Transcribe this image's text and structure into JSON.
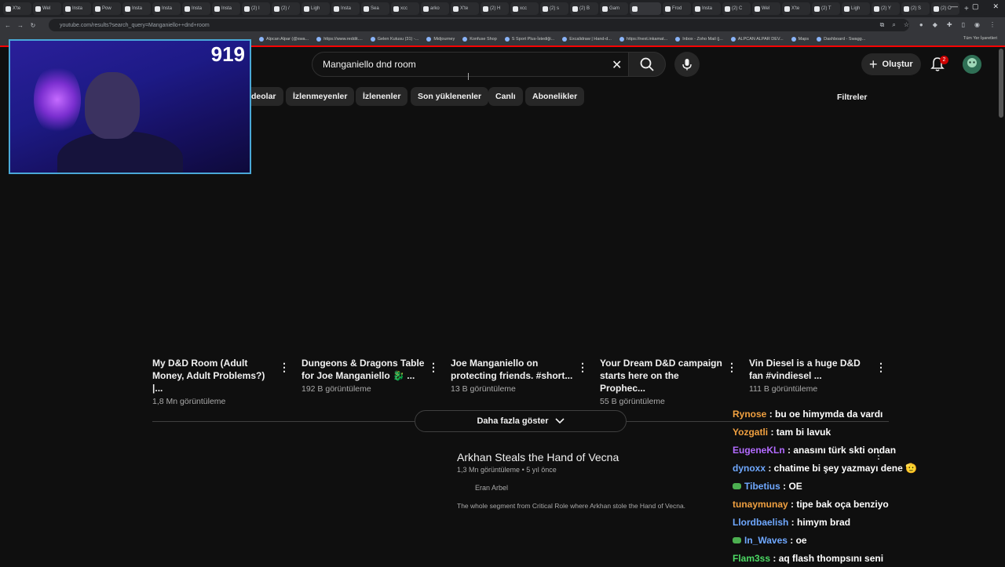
{
  "browser": {
    "tabs": [
      "X'te",
      "Wel",
      "Insta",
      "Pow",
      "Insta",
      "Insta",
      "Insta",
      "Insta",
      "(2) I",
      "(2) /",
      "Ligh",
      "Insta",
      "Sea",
      "xcc",
      "arko",
      "X'te",
      "(2) H",
      "xcc",
      "(2) s",
      "(2) B",
      "Gam",
      "",
      "Frod",
      "Insta",
      "(2) C",
      "Wel",
      "X'te",
      "(2) T",
      "Ligh",
      "(2) Y",
      "(2) S",
      "(2) O"
    ],
    "url": "youtube.com/results?search_query=Manganiello++dnd+room",
    "bookmarks": [
      "Alpcan Alpar (@swa...",
      "https://www.reddit....",
      "Gelen Kutusu (31) -...",
      "Midjourney",
      "Konfuse Shop",
      "S Sport Plus-İstediği...",
      "Excalidraw | Hand-d...",
      "https://next.inkamat...",
      "Inbox - Zoho Mail (j...",
      "ALPCAN ALPAR DEV...",
      "Maps",
      "Dashboard - Swagg..."
    ],
    "all_bookmarks": "Tüm Yer İşaretleri"
  },
  "header": {
    "search_value": "Manganiello  dnd room",
    "create_label": "Oluştur",
    "notification_count": "2"
  },
  "chips": [
    "deolar",
    "İzlenmeyenler",
    "İzlenenler",
    "Son yüklenenler",
    "Canlı",
    "Abonelikler"
  ],
  "filters_label": "Filtreler",
  "shorts": [
    {
      "title": "My D&D Room (Adult Money, Adult Problems?) |...",
      "views": "1,8 Mn görüntüleme"
    },
    {
      "title": "Dungeons & Dragons Table for Joe Manganiello 🐉 ...",
      "views": "192 B görüntüleme"
    },
    {
      "title": "Joe Manganiello on protecting friends. #short...",
      "views": "13 B görüntüleme"
    },
    {
      "title": "Your Dream D&D campaign starts here on the Prophec...",
      "views": "55 B görüntüleme"
    },
    {
      "title": "Vin Diesel is a huge D&D fan #vindiesel ...",
      "views": "111 B görüntüleme"
    }
  ],
  "show_more_label": "Daha fazla göster",
  "video": {
    "title": "Arkhan Steals the Hand of Vecna",
    "views": "1,3 Mn görüntüleme",
    "age": "5 yıl önce",
    "channel": "Eran Arbel",
    "description": "The whole segment from Critical Role where Arkhan stole the Hand of Vecna."
  },
  "webcam": {
    "counter": "919"
  },
  "chat": [
    {
      "user": "Rynose",
      "color": "#f0a040",
      "msg": " : bu oe himymda da vardı"
    },
    {
      "user": "Yozgatli",
      "color": "#f0a040",
      "msg": " : tam bi lavuk"
    },
    {
      "user": "EugeneKLn",
      "color": "#b36bff",
      "msg": " : anasını türk skti ondan"
    },
    {
      "user": "dynoxx",
      "color": "#6fa8ff",
      "msg": " : chatime bi şey yazmayı dene 🫡"
    },
    {
      "user": "Tibetius",
      "color": "#6fa8ff",
      "msg": " : OE",
      "icon": true
    },
    {
      "user": "tunaymunay",
      "color": "#f0a040",
      "msg": " : tipe bak oça benziyo"
    },
    {
      "user": "Llordbaelish",
      "color": "#6fa8ff",
      "msg": " : himym brad"
    },
    {
      "user": "In_Waves",
      "color": "#6fa8ff",
      "msg": " : oe",
      "icon": true
    },
    {
      "user": "Flam3ss",
      "color": "#4cd964",
      "msg": " : aq flash thompsını seni"
    }
  ]
}
